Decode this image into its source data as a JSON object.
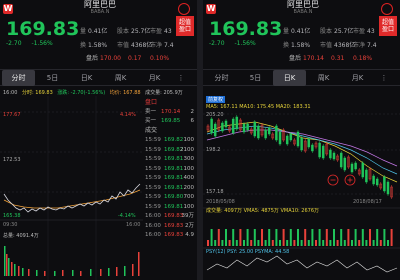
{
  "left": {
    "stock_name": "阿里巴巴",
    "stock_code": "BABA.N",
    "alert_label": "超值\n盈口",
    "price": "169.83",
    "change": "-2.70",
    "change_pct": "-1.56%",
    "stats": [
      {
        "k": "量",
        "v": "0.41亿"
      },
      {
        "k": "股本",
        "v": "25.7亿"
      },
      {
        "k": "市盈",
        "v": "43"
      },
      {
        "k": "换",
        "v": "1.58%"
      },
      {
        "k": "市值",
        "v": "4368亿"
      },
      {
        "k": "市净",
        "v": "7.4"
      }
    ],
    "after_hours_label": "盘后",
    "after_hours_price": "170.00",
    "after_hours_chg": "0.17",
    "after_hours_pct": "0.10%",
    "tabs": [
      "分时",
      "5日",
      "日K",
      "周K",
      "月K"
    ],
    "chart_info_time": "16:00",
    "chart_info_price": "分时: 169.83",
    "chart_info_change": "涨跌: -2.70(-1.56%)",
    "chart_info_avg": "均价: 167.88",
    "chart_info_vol": "成交量: 205.9万",
    "y_top": "177.67",
    "y_mid": "172.53",
    "y_low": "165.38",
    "pct_top": "4.14%",
    "pct_low": "-4.14%",
    "x_start": "09:30",
    "x_end": "16:00",
    "vol_label": "总量: 4091.4万",
    "book_header": "盘口",
    "book": [
      {
        "l": "卖一",
        "p": "170.14",
        "v": "2"
      },
      {
        "l": "买一",
        "p": "169.85",
        "v": "6"
      }
    ],
    "trade_header": "成交",
    "trades": [
      {
        "t": "15:59",
        "p": "169.82",
        "v": "100"
      },
      {
        "t": "15:59",
        "p": "169.82",
        "v": "2100"
      },
      {
        "t": "15:59",
        "p": "169.81",
        "v": "300"
      },
      {
        "t": "15:59",
        "p": "169.81",
        "v": "100"
      },
      {
        "t": "15:59",
        "p": "169.81",
        "v": "400"
      },
      {
        "t": "15:59",
        "p": "169.81",
        "v": "200"
      },
      {
        "t": "15:59",
        "p": "169.80",
        "v": "700"
      },
      {
        "t": "15:59",
        "p": "169.81",
        "v": "100"
      },
      {
        "t": "16:00",
        "p": "169.83",
        "v": "39万"
      },
      {
        "t": "16:00",
        "p": "169.83",
        "v": "2万"
      },
      {
        "t": "16:00",
        "p": "169.83",
        "v": "4.9"
      }
    ]
  },
  "right": {
    "stock_name": "阿里巴巴",
    "stock_code": "BABA.N",
    "alert_label": "超值\n盈口",
    "price": "169.83",
    "change": "-2.70",
    "change_pct": "-1.56%",
    "stats": [
      {
        "k": "量",
        "v": "0.41亿"
      },
      {
        "k": "股本",
        "v": "25.7亿"
      },
      {
        "k": "市盈",
        "v": "43"
      },
      {
        "k": "换",
        "v": "1.58%"
      },
      {
        "k": "市值",
        "v": "4368亿"
      },
      {
        "k": "市净",
        "v": "7.4"
      }
    ],
    "after_hours_label": "盘后",
    "after_hours_price": "170.14",
    "after_hours_chg": "0.31",
    "after_hours_pct": "0.18%",
    "tabs": [
      "分时",
      "5日",
      "日K",
      "周K",
      "月K"
    ],
    "adj_label": "前复权",
    "ma_line": "MA5: 167.11  MA10: 175.45  MA20: 183.31",
    "y_top": "205.20",
    "y_mid": "198.2",
    "y_low": "157.18",
    "x_start": "2018/05/08",
    "x_end": "2018/08/17",
    "vol_line": "成交量: 4097万  VMA5: 4875万  VMA10: 2676万",
    "psy_line": "PSY(12)  PSY: 25.00  PSYMA: 44.58"
  },
  "colors": {
    "up": "#e8413a",
    "down": "#20c45a",
    "bg": "#0d0d10",
    "accent": "#e02a2a"
  }
}
